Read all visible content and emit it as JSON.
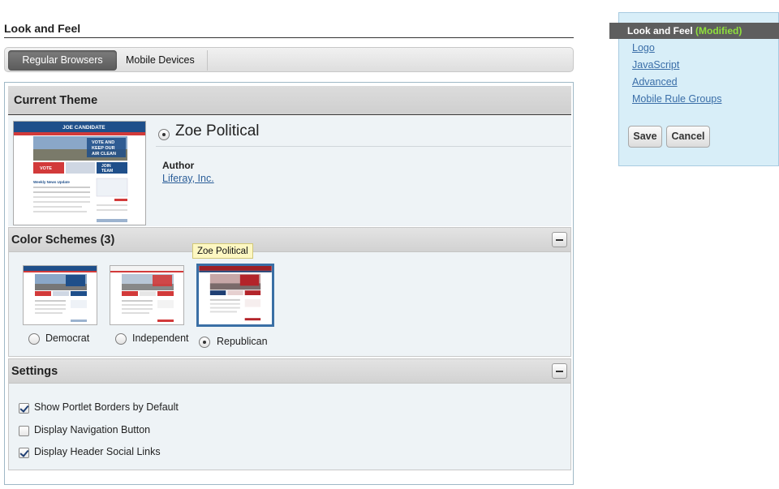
{
  "page": {
    "title": "Look and Feel"
  },
  "tabs": [
    {
      "label": "Regular Browsers",
      "active": true
    },
    {
      "label": "Mobile Devices",
      "active": false
    }
  ],
  "current_theme": {
    "header": "Current Theme",
    "name": "Zoe Political",
    "author_label": "Author",
    "author": "Liferay, Inc.",
    "thumbnail": {
      "site_title": "JOE CANDIDATE",
      "hero_lines": [
        "VOTE AND",
        "KEEP OUR",
        "AIR CLEAN"
      ],
      "vote_label": "VOTE",
      "join_label": [
        "JOIN",
        "TEAM"
      ],
      "news_title": "Weekly News Update"
    }
  },
  "color_schemes": {
    "header": "Color Schemes (3)",
    "tooltip": "Zoe Political",
    "items": [
      {
        "label": "Democrat",
        "selected": false,
        "accent": "#1f4f8a"
      },
      {
        "label": "Independent",
        "selected": false,
        "accent": "#d23a3a"
      },
      {
        "label": "Republican",
        "selected": true,
        "accent": "#b3242a"
      }
    ]
  },
  "settings": {
    "header": "Settings",
    "items": [
      {
        "label": "Show Portlet Borders by Default",
        "checked": true
      },
      {
        "label": "Display Navigation Button",
        "checked": false
      },
      {
        "label": "Display Header Social Links",
        "checked": true
      }
    ]
  },
  "sidebar": {
    "active_label": "Look and Feel",
    "active_status": "(Modified)",
    "links": [
      "Logo",
      "JavaScript",
      "Advanced",
      "Mobile Rule Groups"
    ],
    "save_label": "Save",
    "cancel_label": "Cancel"
  },
  "colors": {
    "brand_blue": "#2a5d98",
    "modified_green": "#8fe03d",
    "sidebar_bg": "#d8eef8"
  }
}
